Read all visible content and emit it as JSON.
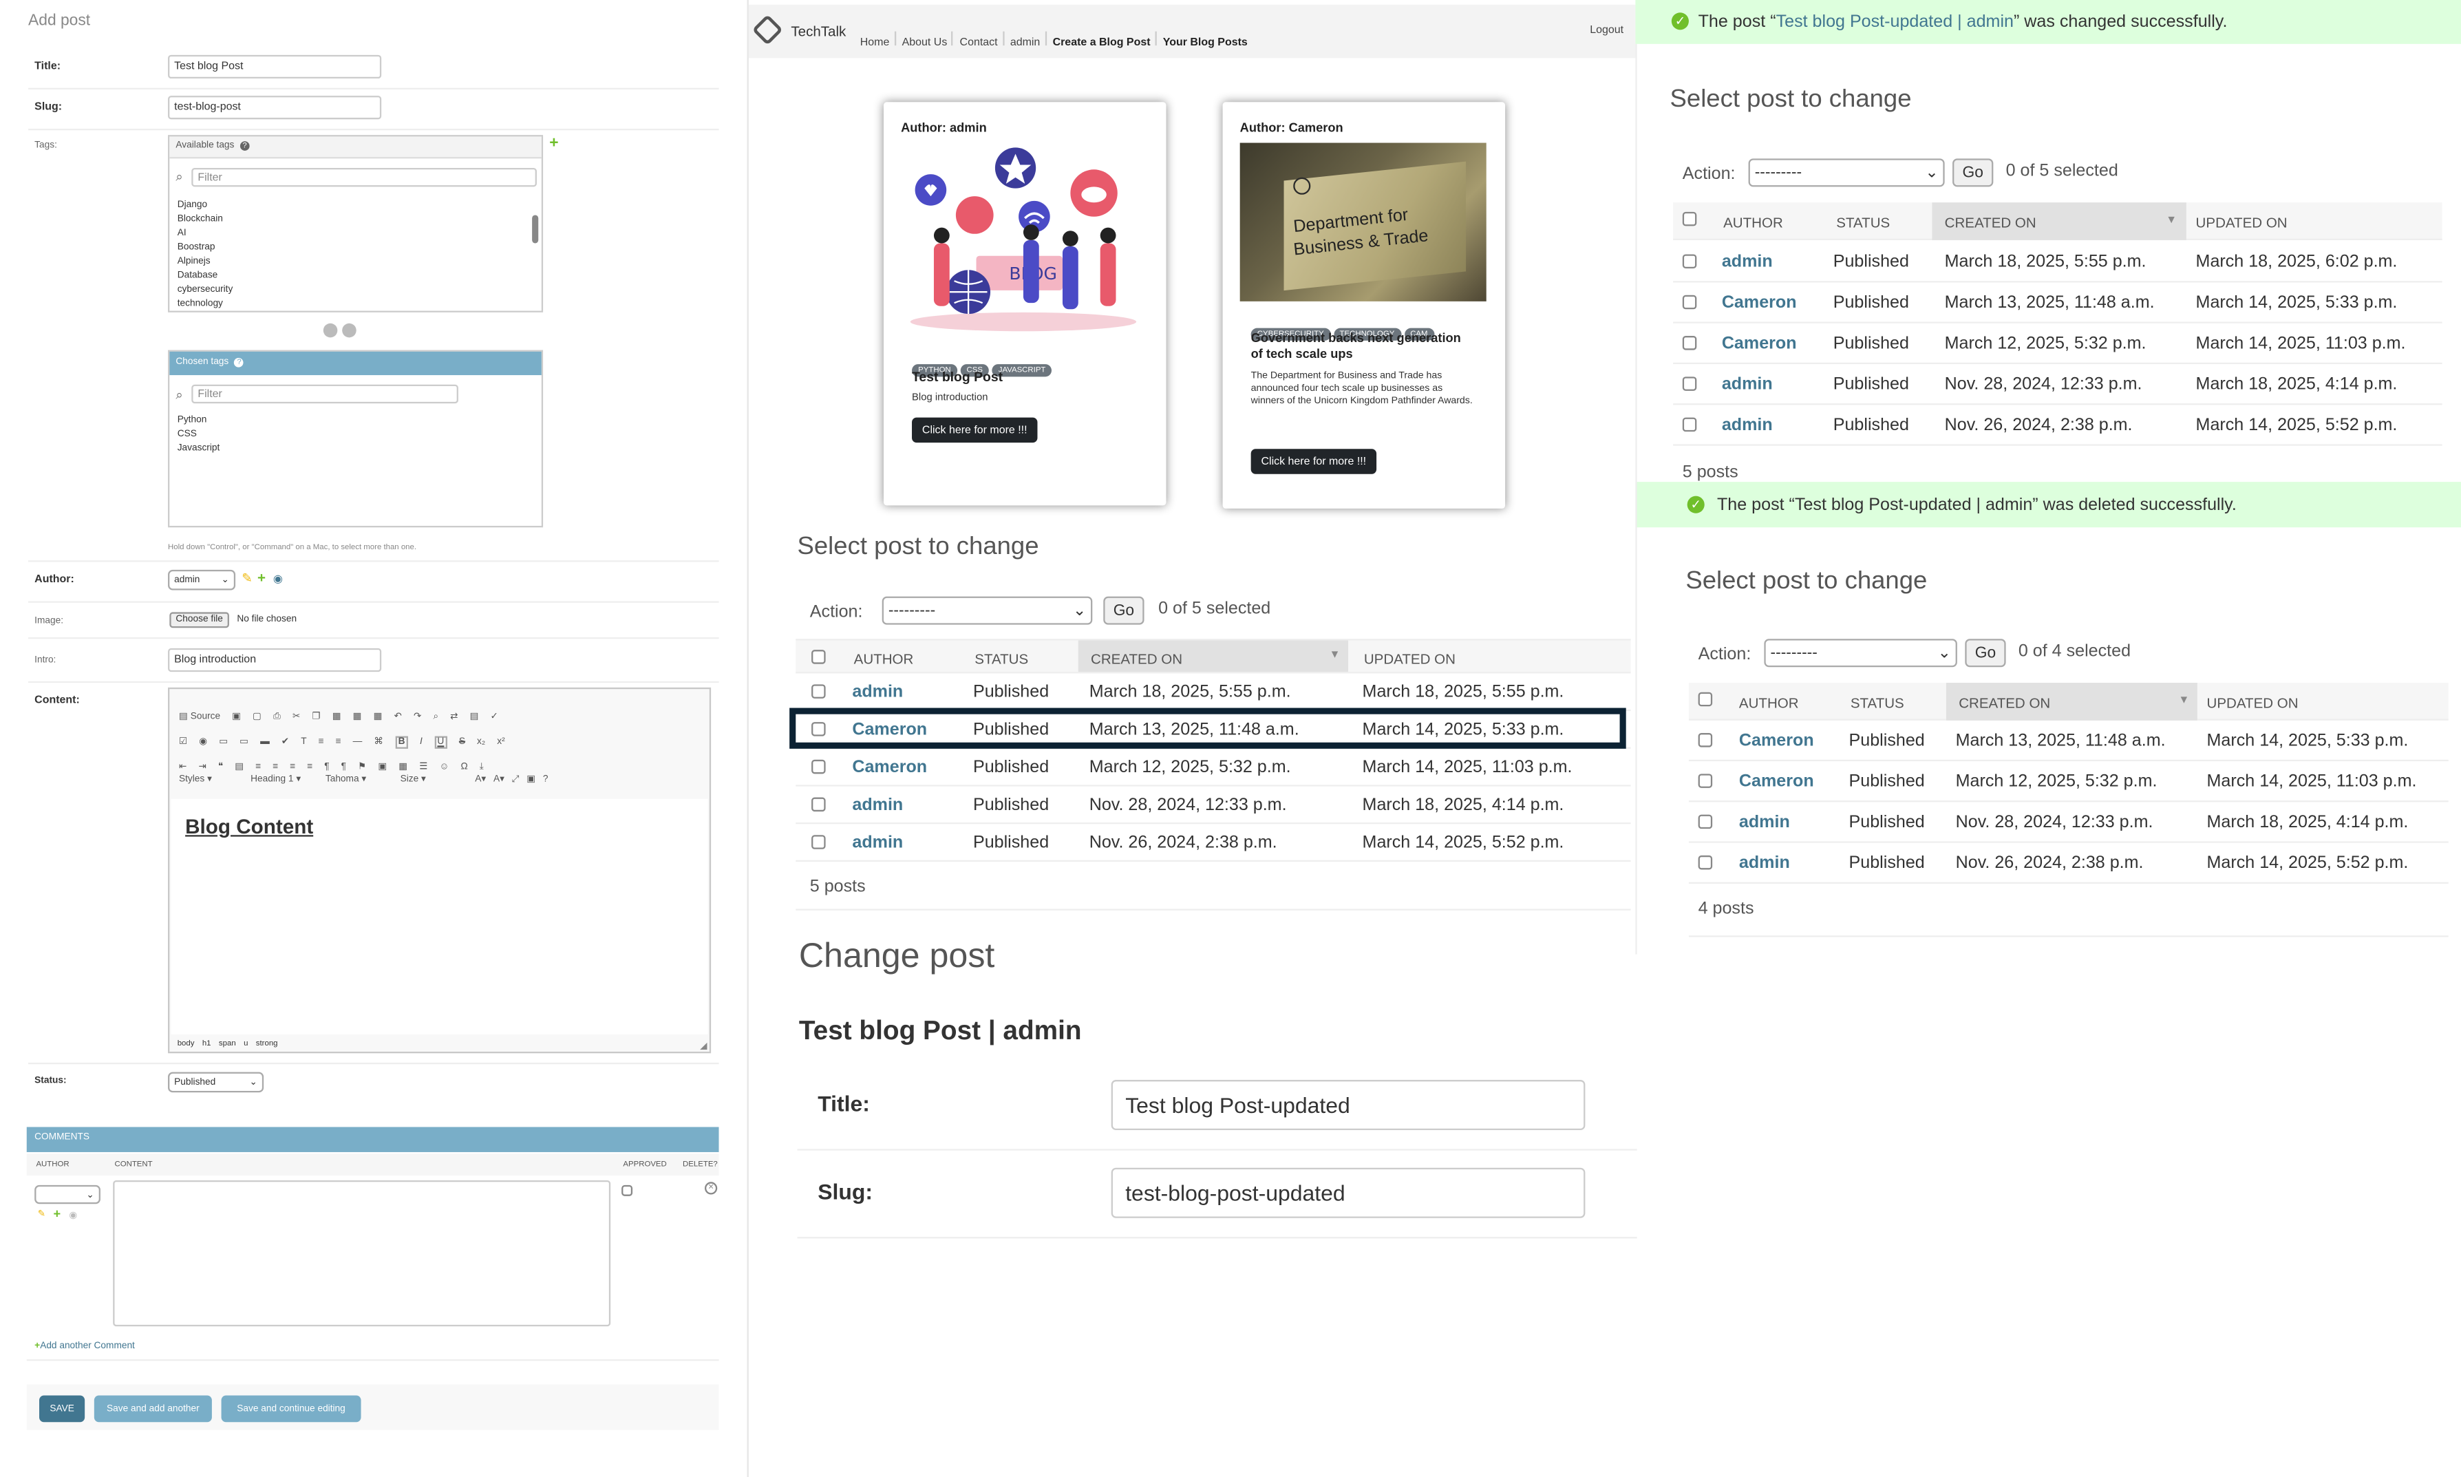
{
  "add_post": {
    "heading": "Add post",
    "fields": {
      "title_label": "Title:",
      "title_value": "Test blog Post",
      "slug_label": "Slug:",
      "slug_value": "test-blog-post",
      "tags_label": "Tags:",
      "available_tags_label": "Available tags",
      "filter_placeholder": "Filter",
      "available_tags": [
        "Django",
        "Blockchain",
        "AI",
        "Boostrap",
        "Alpinejs",
        "Database",
        "cybersecurity",
        "technology"
      ],
      "chosen_tags_label": "Chosen tags",
      "chosen_tags": [
        "Python",
        "CSS",
        "Javascript"
      ],
      "tags_help": "Hold down \"Control\", or \"Command\" on a Mac, to select more than one.",
      "author_label": "Author:",
      "author_value": "admin",
      "image_label": "Image:",
      "choose_file": "Choose file",
      "no_file": "No file chosen",
      "intro_label": "Intro:",
      "intro_value": "Blog introduction",
      "content_label": "Content:",
      "editor_source": "Source",
      "editor_styles": "Styles",
      "editor_heading": "Heading 1",
      "editor_font": "Tahoma",
      "editor_size": "Size",
      "editor_content": "Blog Content",
      "editor_path": [
        "body",
        "h1",
        "span",
        "u",
        "strong"
      ],
      "status_label": "Status:",
      "status_value": "Published"
    },
    "comments": {
      "header": "COMMENTS",
      "col_author": "AUTHOR",
      "col_content": "CONTENT",
      "col_approved": "APPROVED",
      "col_delete": "DELETE?",
      "add_another": "Add another Comment"
    },
    "buttons": {
      "save": "SAVE",
      "save_add_another": "Save and add another",
      "save_continue": "Save and continue editing"
    }
  },
  "site": {
    "brand": "TechTalk",
    "nav": [
      "Home",
      "About Us",
      "Contact",
      "admin",
      "Create a Blog Post",
      "Your Blog Posts"
    ],
    "logout": "Logout",
    "cards": [
      {
        "author": "Author: admin",
        "tags": [
          "PYTHON",
          "CSS",
          "JAVASCRIPT"
        ],
        "title": "Test blog Post",
        "intro": "Blog introduction",
        "button": "Click here for more !!!",
        "illustration_text": "BLOG"
      },
      {
        "author": "Author: Cameron",
        "tags": [
          "CYBERSECURITY",
          "TECHNOLOGY",
          "CAM"
        ],
        "title": "Government backs next generation of tech scale ups",
        "intro": "The Department for Business and Trade has announced four tech scale up businesses as winners of the Unicorn Kingdom Pathfinder Awards.",
        "button": "Click here for more !!!",
        "photo_text_1": "Department for",
        "photo_text_2": "Business & Trade"
      }
    ]
  },
  "list_middle": {
    "heading": "Select post to change",
    "action_label": "Action:",
    "action_value": "---------",
    "go": "Go",
    "selected": "0 of 5 selected",
    "columns": [
      "AUTHOR",
      "STATUS",
      "CREATED ON",
      "UPDATED ON"
    ],
    "rows": [
      {
        "author": "admin",
        "status": "Published",
        "created": "March 18, 2025, 5:55 p.m.",
        "updated": "March 18, 2025, 5:55 p.m."
      },
      {
        "author": "Cameron",
        "status": "Published",
        "created": "March 13, 2025, 11:48 a.m.",
        "updated": "March 14, 2025, 5:33 p.m."
      },
      {
        "author": "Cameron",
        "status": "Published",
        "created": "March 12, 2025, 5:32 p.m.",
        "updated": "March 14, 2025, 11:03 p.m."
      },
      {
        "author": "admin",
        "status": "Published",
        "created": "Nov. 28, 2024, 12:33 p.m.",
        "updated": "March 18, 2025, 4:14 p.m."
      },
      {
        "author": "admin",
        "status": "Published",
        "created": "Nov. 26, 2024, 2:38 p.m.",
        "updated": "March 14, 2025, 5:52 p.m."
      }
    ],
    "count": "5 posts"
  },
  "change_post": {
    "heading": "Change post",
    "object_title": "Test blog Post | admin",
    "title_label": "Title:",
    "title_value": "Test blog Post-updated",
    "slug_label": "Slug:",
    "slug_value": "test-blog-post-updated"
  },
  "list_top_right": {
    "message_prefix": "The post “",
    "message_link": "Test blog Post-updated | admin",
    "message_suffix": "” was changed successfully.",
    "heading": "Select post to change",
    "action_label": "Action:",
    "action_value": "---------",
    "go": "Go",
    "selected": "0 of 5 selected",
    "columns": [
      "AUTHOR",
      "STATUS",
      "CREATED ON",
      "UPDATED ON"
    ],
    "rows": [
      {
        "author": "admin",
        "status": "Published",
        "created": "March 18, 2025, 5:55 p.m.",
        "updated": "March 18, 2025, 6:02 p.m."
      },
      {
        "author": "Cameron",
        "status": "Published",
        "created": "March 13, 2025, 11:48 a.m.",
        "updated": "March 14, 2025, 5:33 p.m."
      },
      {
        "author": "Cameron",
        "status": "Published",
        "created": "March 12, 2025, 5:32 p.m.",
        "updated": "March 14, 2025, 11:03 p.m."
      },
      {
        "author": "admin",
        "status": "Published",
        "created": "Nov. 28, 2024, 12:33 p.m.",
        "updated": "March 18, 2025, 4:14 p.m."
      },
      {
        "author": "admin",
        "status": "Published",
        "created": "Nov. 26, 2024, 2:38 p.m.",
        "updated": "March 14, 2025, 5:52 p.m."
      }
    ],
    "count": "5 posts"
  },
  "list_bottom_right": {
    "message": "The post “Test blog Post-updated | admin” was deleted successfully.",
    "heading": "Select post to change",
    "action_label": "Action:",
    "action_value": "---------",
    "go": "Go",
    "selected": "0 of 4 selected",
    "columns": [
      "AUTHOR",
      "STATUS",
      "CREATED ON",
      "UPDATED ON"
    ],
    "rows": [
      {
        "author": "Cameron",
        "status": "Published",
        "created": "March 13, 2025, 11:48 a.m.",
        "updated": "March 14, 2025, 5:33 p.m."
      },
      {
        "author": "Cameron",
        "status": "Published",
        "created": "March 12, 2025, 5:32 p.m.",
        "updated": "March 14, 2025, 11:03 p.m."
      },
      {
        "author": "admin",
        "status": "Published",
        "created": "Nov. 28, 2024, 12:33 p.m.",
        "updated": "March 18, 2025, 4:14 p.m."
      },
      {
        "author": "admin",
        "status": "Published",
        "created": "Nov. 26, 2024, 2:38 p.m.",
        "updated": "March 14, 2025, 5:52 p.m."
      }
    ],
    "count": "4 posts"
  },
  "colors": {
    "admin_blue": "#417690",
    "module_header": "#79aec8",
    "success_bg": "#dfd",
    "success_icon": "#70bf2b",
    "highlight_border": "#0c2233"
  }
}
